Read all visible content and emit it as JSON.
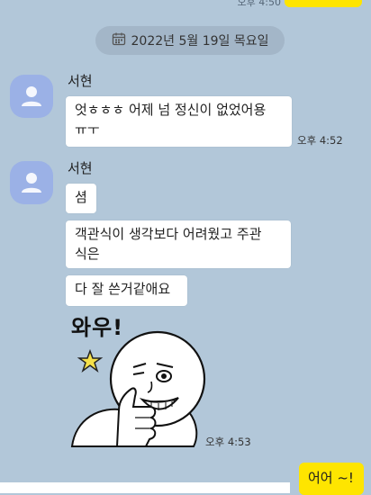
{
  "date_divider": {
    "label": "2022년 5월 19일 목요일",
    "icon": "calendar-icon"
  },
  "top_message": {
    "time": "오후 4:50"
  },
  "messages": [
    {
      "sender": "서현",
      "bubbles": [
        "엇ㅎㅎㅎ 어제 넘 정신이 없었어용\nㅠㅜ"
      ],
      "time": "오후 4:52"
    },
    {
      "sender": "서현",
      "bubbles": [
        "셤",
        "객관식이 생각보다 어려웠고 주관\n식은",
        "다 잘 쓴거같애요"
      ],
      "sticker_caption": "와우!",
      "time": "오후 4:53"
    }
  ],
  "outgoing": {
    "text": "어어 ~!"
  },
  "colors": {
    "background": "#b2c7d9",
    "my_bubble": "#fee500",
    "avatar": "#9bb1e6"
  }
}
